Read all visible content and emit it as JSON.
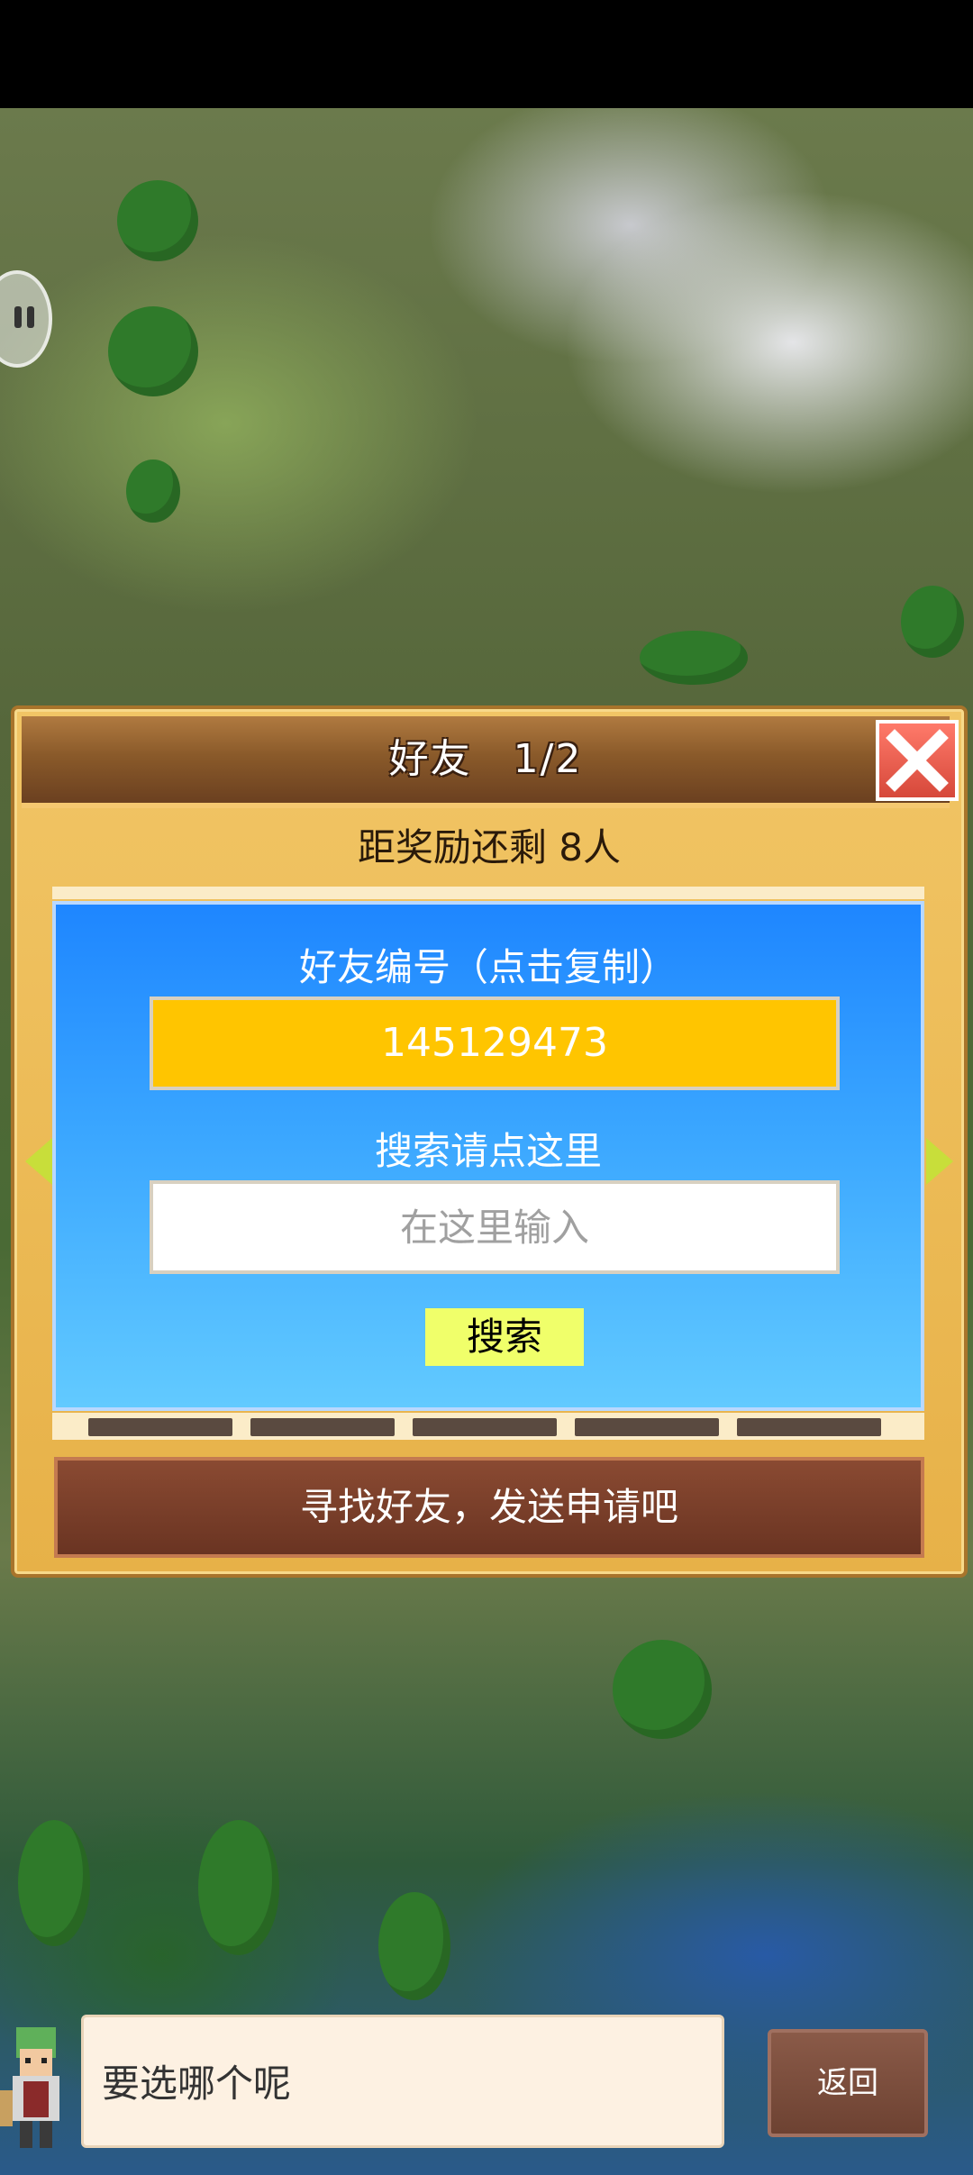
{
  "dialog": {
    "title": "好友　1/2",
    "reward_text": "距奖励还剩 8人",
    "friend_id_label": "好友编号（点击复制）",
    "friend_id": "145129473",
    "search_label": "搜索请点这里",
    "search_placeholder": "在这里输入",
    "search_button": "搜索",
    "find_friends_text": "寻找好友，发送申请吧"
  },
  "footer": {
    "speech_text": "要选哪个呢",
    "back_button": "返回"
  },
  "icons": {
    "close": "close-icon",
    "prev": "arrow-left-icon",
    "next": "arrow-right-icon",
    "pause": "pause-icon",
    "avatar": "character-avatar"
  },
  "colors": {
    "panel_blue": "#1e86ff",
    "friend_id_bg": "#ffc500",
    "search_button_bg": "#f0ff6a",
    "close_red": "#e0584a"
  }
}
